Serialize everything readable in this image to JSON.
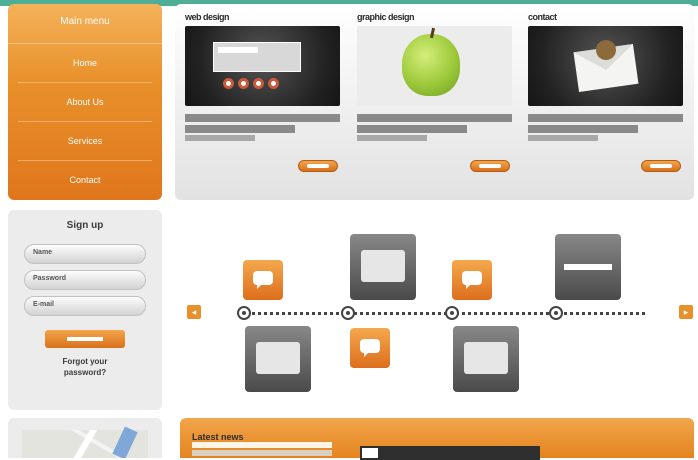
{
  "menu": {
    "title": "Main menu",
    "items": [
      "Home",
      "About Us",
      "Services",
      "Contact"
    ]
  },
  "featured": {
    "cards": [
      {
        "title": "web design",
        "thumb": "ui-window-thumbnail"
      },
      {
        "title": "graphic design",
        "thumb": "apple-thumbnail"
      },
      {
        "title": "contact",
        "thumb": "envelope-thumbnail"
      }
    ]
  },
  "signup": {
    "title": "Sign up",
    "fields": [
      "Name",
      "Password",
      "E-mail"
    ],
    "forgot_line1": "Forgot your",
    "forgot_line2": "password?"
  },
  "bottom": {
    "title": "Latest news"
  },
  "colors": {
    "accent_orange": "#e8902a",
    "top_strip": "#4fae96",
    "panel_gray": "#ececec"
  }
}
